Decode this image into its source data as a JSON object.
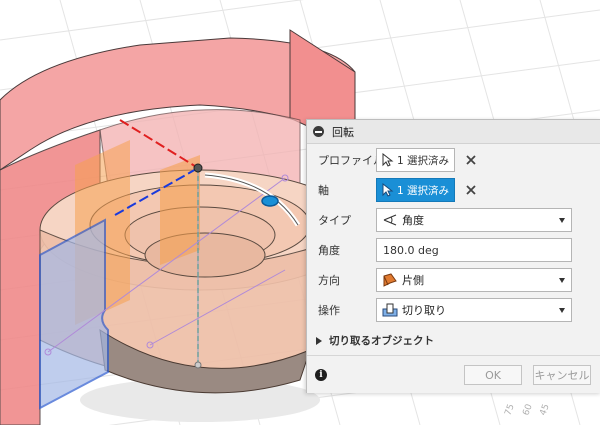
{
  "dialog": {
    "title": "回転",
    "rows": {
      "profile": {
        "label": "プロファイル",
        "value": "1 選択済み"
      },
      "axis": {
        "label": "軸",
        "value": "1 選択済み"
      },
      "type": {
        "label": "タイプ",
        "value": "角度"
      },
      "angle": {
        "label": "角度",
        "value": "180.0 deg"
      },
      "direction": {
        "label": "方向",
        "value": "片側"
      },
      "operation": {
        "label": "操作",
        "value": "切り取り"
      }
    },
    "section_label": "切り取るオブジェクト",
    "ok_label": "OK",
    "cancel_label": "キャンセル"
  },
  "viewport": {
    "ruler_labels": [
      "75",
      "60",
      "45"
    ]
  },
  "colors": {
    "accent": "#1a8fd6",
    "body_red": "#f08a8a",
    "body_orange": "#f5b080"
  }
}
